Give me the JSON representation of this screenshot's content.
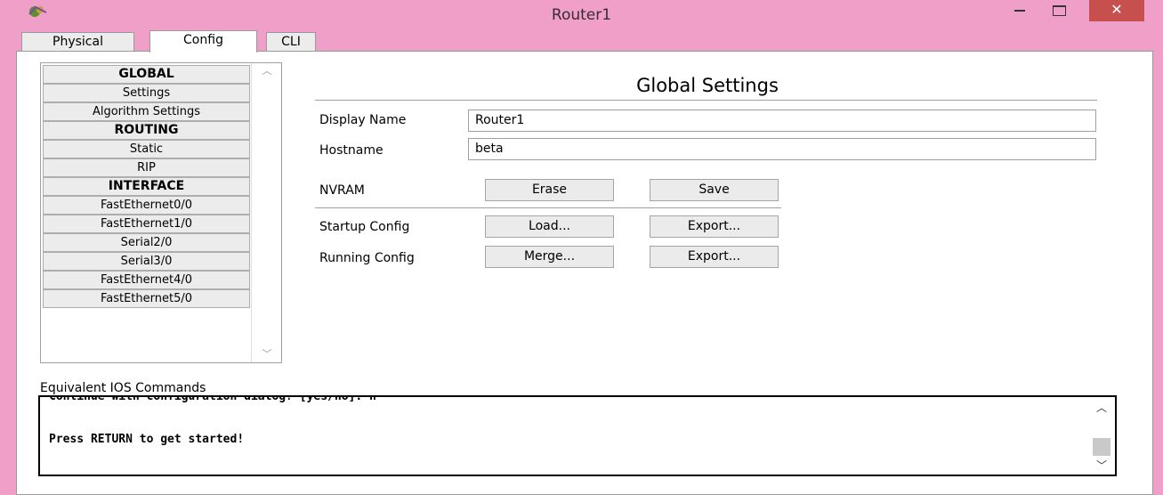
{
  "window": {
    "title": "Router1",
    "close_glyph": "✕",
    "app_icon": "router-app-icon"
  },
  "tabs": [
    {
      "label": "Physical"
    },
    {
      "label": "Config"
    },
    {
      "label": "CLI"
    }
  ],
  "sidebar": {
    "items": [
      {
        "label": "GLOBAL",
        "header": true
      },
      {
        "label": "Settings"
      },
      {
        "label": "Algorithm Settings"
      },
      {
        "label": "ROUTING",
        "header": true
      },
      {
        "label": "Static"
      },
      {
        "label": "RIP"
      },
      {
        "label": "INTERFACE",
        "header": true
      },
      {
        "label": "FastEthernet0/0"
      },
      {
        "label": "FastEthernet1/0"
      },
      {
        "label": "Serial2/0"
      },
      {
        "label": "Serial3/0"
      },
      {
        "label": "FastEthernet4/0"
      },
      {
        "label": "FastEthernet5/0"
      }
    ]
  },
  "main": {
    "title": "Global Settings",
    "display_name_label": "Display Name",
    "display_name_value": "Router1",
    "hostname_label": "Hostname",
    "hostname_value": "beta",
    "nvram_label": "NVRAM",
    "erase_label": "Erase",
    "save_label": "Save",
    "startup_label": "Startup Config",
    "load_label": "Load...",
    "startup_export_label": "Export...",
    "running_label": "Running Config",
    "merge_label": "Merge...",
    "running_export_label": "Export..."
  },
  "ios": {
    "label": "Equivalent IOS Commands",
    "lines": [
      "Continue with configuration dialog? [yes/no]: n",
      "Press RETURN to get started!"
    ]
  },
  "colors": {
    "titlebar": "#f0a0c8",
    "close_button": "#c7504f"
  }
}
